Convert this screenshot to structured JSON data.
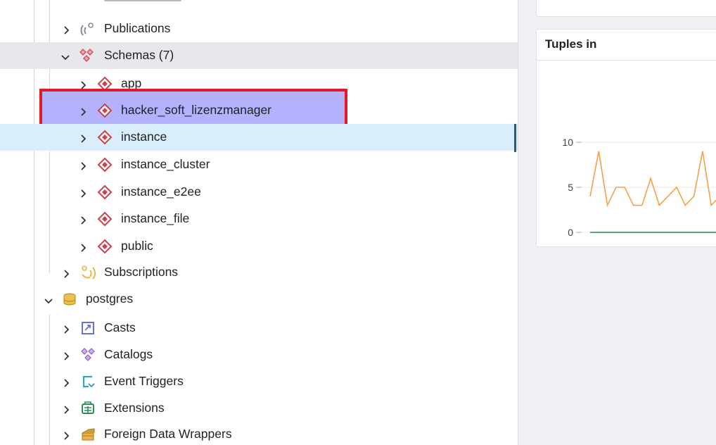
{
  "tree": {
    "items": [
      {
        "label": "Publications",
        "icon": "publications-icon"
      },
      {
        "label": "Schemas (7)",
        "icon": "schemas-icon"
      },
      {
        "label": "app",
        "icon": "schema-icon"
      },
      {
        "label": "hacker_soft_lizenzmanager",
        "icon": "schema-icon"
      },
      {
        "label": "instance",
        "icon": "schema-icon"
      },
      {
        "label": "instance_cluster",
        "icon": "schema-icon"
      },
      {
        "label": "instance_e2ee",
        "icon": "schema-icon"
      },
      {
        "label": "instance_file",
        "icon": "schema-icon"
      },
      {
        "label": "public",
        "icon": "schema-icon"
      },
      {
        "label": "Subscriptions",
        "icon": "subscriptions-icon"
      },
      {
        "label": "postgres",
        "icon": "database-icon"
      },
      {
        "label": "Casts",
        "icon": "casts-icon"
      },
      {
        "label": "Catalogs",
        "icon": "catalogs-icon"
      },
      {
        "label": "Event Triggers",
        "icon": "event-triggers-icon"
      },
      {
        "label": "Extensions",
        "icon": "extensions-icon"
      },
      {
        "label": "Foreign Data Wrappers",
        "icon": "foreign-data-wrappers-icon"
      }
    ]
  },
  "dashboard": {
    "card_title": "Tuples in"
  },
  "colors": {
    "selected_row": "#e6e8ec",
    "hover_row": "#d9edfa",
    "highlight_border": "#e3192a",
    "highlight_fill": "#b4b1fd",
    "schema_icon": "#c9424d",
    "series_inserts": "#f5a04a",
    "series_zero": "#5aa878"
  },
  "chart_data": {
    "type": "line",
    "title": "Tuples in",
    "yticks": [
      "10",
      "5",
      "0"
    ],
    "ylim": [
      0,
      10
    ],
    "series": [
      {
        "values": [
          4,
          9,
          3,
          5,
          5,
          3,
          3,
          6,
          3,
          4,
          5,
          3,
          4,
          9,
          3,
          4
        ]
      },
      {
        "values": [
          0,
          0,
          0,
          0,
          0,
          0,
          0,
          0,
          0,
          0,
          0,
          0,
          0,
          0,
          0,
          0
        ]
      }
    ]
  }
}
